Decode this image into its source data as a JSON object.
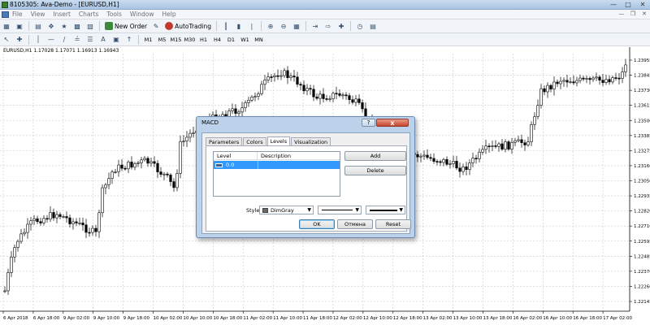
{
  "window": {
    "title": "8105305: Ava-Demo - [EURUSD,H1]",
    "min_icon": "minimize-icon",
    "max_icon": "maximize-icon",
    "close_icon": "close-icon"
  },
  "menu": {
    "items": [
      "File",
      "View",
      "Insert",
      "Charts",
      "Tools",
      "Window",
      "Help"
    ]
  },
  "toolbar": {
    "new_order": "New Order",
    "auto_trading": "AutoTrading",
    "timeframes": [
      "M1",
      "M5",
      "M15",
      "M30",
      "H1",
      "H4",
      "D1",
      "W1",
      "MN"
    ]
  },
  "chart": {
    "symbol_info": "EURUSD,H1  1.17028 1.17071 1.16913 1.16943",
    "price_labels": [
      "1.23955",
      "1.23845",
      "1.23730",
      "1.23615",
      "1.23500",
      "1.23385",
      "1.23275",
      "1.23160",
      "1.23050",
      "1.22935",
      "1.22820",
      "1.22710",
      "1.22595",
      "1.22485",
      "1.22370",
      "1.22260",
      "1.22145"
    ],
    "time_labels": [
      "6 Apr 2018",
      "6 Apr 18:00",
      "9 Apr 02:00",
      "9 Apr 10:00",
      "9 Apr 18:00",
      "10 Apr 02:00",
      "10 Apr 10:00",
      "10 Apr 18:00",
      "11 Apr 02:00",
      "11 Apr 10:00",
      "11 Apr 18:00",
      "12 Apr 02:00",
      "12 Apr 10:00",
      "12 Apr 18:00",
      "13 Apr 02:00",
      "13 Apr 10:00",
      "13 Apr 18:00",
      "16 Apr 02:00",
      "16 Apr 10:00",
      "16 Apr 18:00",
      "17 Apr 02:00"
    ],
    "candle_color": "#000000",
    "grid_color": "#c8c8c8"
  },
  "dialog": {
    "title": "MACD",
    "help_label": "?",
    "close_label": "x",
    "tabs": [
      {
        "label": "Parameters",
        "active": false
      },
      {
        "label": "Colors",
        "active": false
      },
      {
        "label": "Levels",
        "active": true
      },
      {
        "label": "Visualization",
        "active": false
      }
    ],
    "levels_table": {
      "col_level": "Level",
      "col_description": "Description",
      "rows": [
        {
          "level": "0.0",
          "description": ""
        }
      ]
    },
    "add_label": "Add",
    "delete_label": "Delete",
    "style_label": "Style:",
    "color_value": "DimGray",
    "color_hex": "#696969",
    "ok_label": "OK",
    "cancel_label": "Отмена",
    "reset_label": "Reset"
  }
}
